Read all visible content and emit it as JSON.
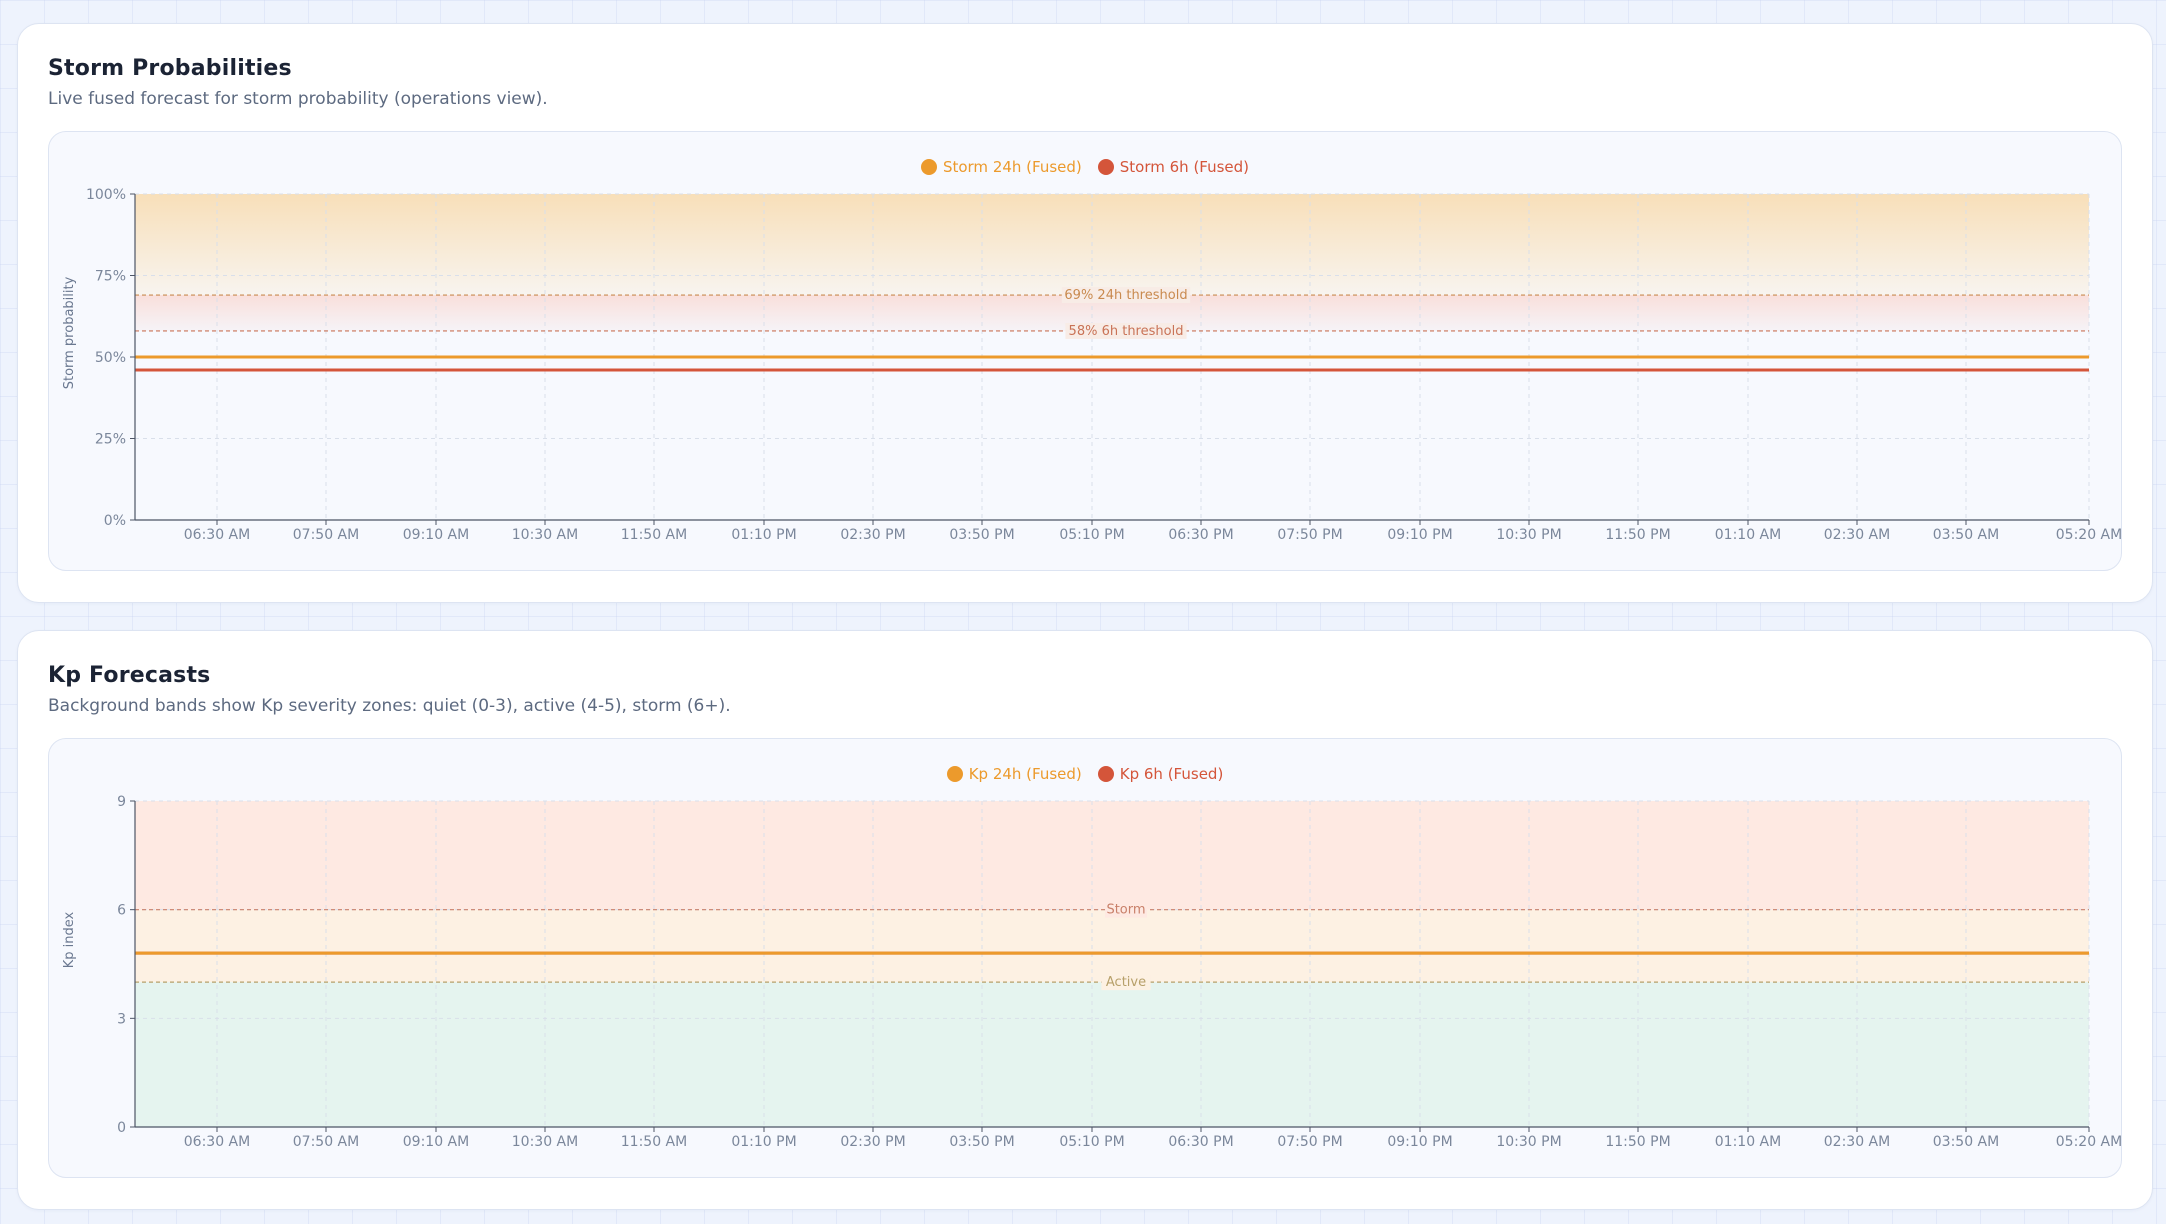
{
  "storm_card": {
    "title": "Storm Probabilities",
    "subtitle": "Live fused forecast for storm probability (operations view)."
  },
  "kp_card": {
    "title": "Kp Forecasts",
    "subtitle": "Background bands show Kp severity zones: quiet (0-3), active (4-5), storm (6+)."
  },
  "colors": {
    "orange": "#ec9a2c",
    "red": "#d4553a"
  },
  "chart_data": [
    {
      "type": "line",
      "ylabel": "Storm probability",
      "ylim": [
        0,
        100
      ],
      "y_ticks": [
        "0%",
        "25%",
        "50%",
        "75%",
        "100%"
      ],
      "y_tick_values": [
        0,
        25,
        50,
        75,
        100
      ],
      "x_ticks": [
        "06:30 AM",
        "07:50 AM",
        "09:10 AM",
        "10:30 AM",
        "11:50 AM",
        "01:10 PM",
        "02:30 PM",
        "03:50 PM",
        "05:10 PM",
        "06:30 PM",
        "07:50 PM",
        "09:10 PM",
        "10:30 PM",
        "11:50 PM",
        "01:10 AM",
        "02:30 AM",
        "03:50 AM",
        "05:20 AM"
      ],
      "series": [
        {
          "name": "Storm 24h (Fused)",
          "color": "#ec9a2c",
          "values": [
            50,
            50
          ]
        },
        {
          "name": "Storm 6h (Fused)",
          "color": "#d4553a",
          "values": [
            46,
            46
          ]
        }
      ],
      "thresholds": [
        {
          "value": 69,
          "label": "69% 24h threshold",
          "color": "#c98a4f"
        },
        {
          "value": 58,
          "label": "58% 6h threshold",
          "color": "#c97357"
        }
      ],
      "grid": true,
      "legend": "top-center"
    },
    {
      "type": "line",
      "ylabel": "Kp index",
      "ylim": [
        0,
        9
      ],
      "y_ticks": [
        "0",
        "3",
        "6",
        "9"
      ],
      "y_tick_values": [
        0,
        3,
        6,
        9
      ],
      "x_ticks": [
        "06:30 AM",
        "07:50 AM",
        "09:10 AM",
        "10:30 AM",
        "11:50 AM",
        "01:10 PM",
        "02:30 PM",
        "03:50 PM",
        "05:10 PM",
        "06:30 PM",
        "07:50 PM",
        "09:10 PM",
        "10:30 PM",
        "11:50 PM",
        "01:10 AM",
        "02:30 AM",
        "03:50 AM",
        "05:20 AM"
      ],
      "series": [
        {
          "name": "Kp 24h (Fused)",
          "color": "#ec9a2c",
          "values": [
            4.8,
            4.8
          ]
        },
        {
          "name": "Kp 6h (Fused)",
          "color": "#d4553a",
          "values": [
            4.8,
            4.8
          ]
        }
      ],
      "thresholds": [
        {
          "value": 6,
          "label": "Storm",
          "color": "#c9806a"
        },
        {
          "value": 4,
          "label": "Active",
          "color": "#b7a06a"
        }
      ],
      "bands": [
        {
          "from": 0,
          "to": 4,
          "color": "#e5f4ef"
        },
        {
          "from": 4,
          "to": 6,
          "color": "#fdf1e3"
        },
        {
          "from": 6,
          "to": 9,
          "color": "#fee9e2"
        }
      ],
      "grid": true,
      "legend": "top-center"
    }
  ]
}
